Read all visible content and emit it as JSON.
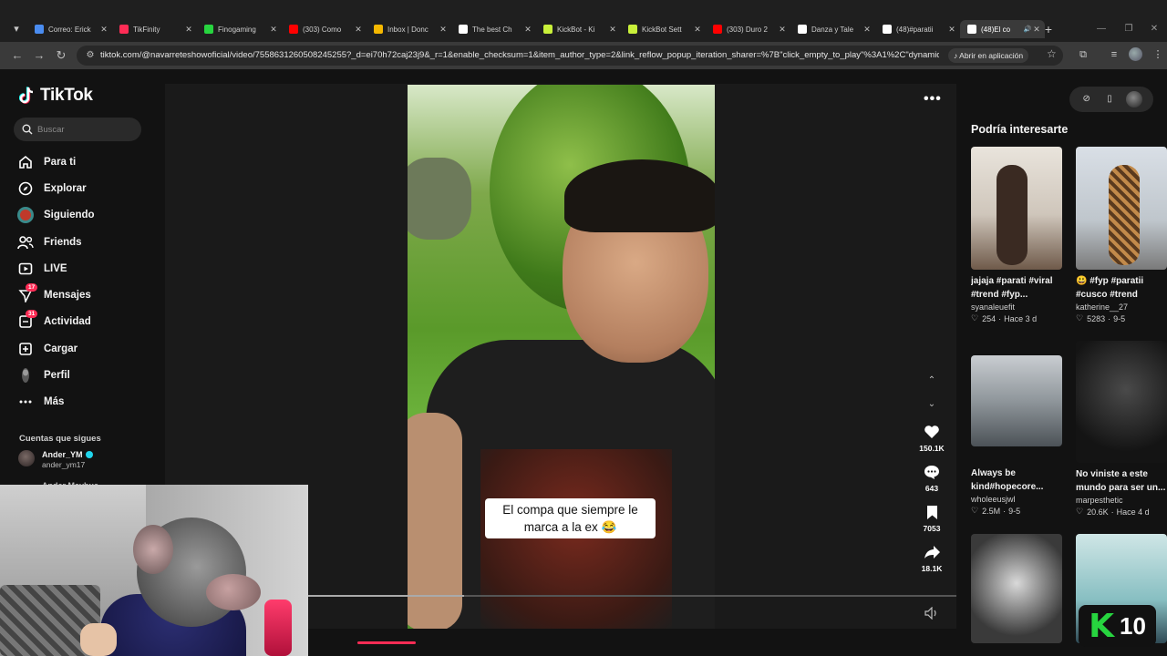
{
  "browser": {
    "tabs": [
      {
        "title": "Correo: Erick",
        "favicon_color": "#4a8cf0",
        "favicon_glyph": "mail-icon"
      },
      {
        "title": "TikFinity",
        "favicon_color": "#fe2c55",
        "favicon_glyph": "tikfinity-icon"
      },
      {
        "title": "Finogaming",
        "favicon_color": "#27d43f",
        "favicon_glyph": "k-icon"
      },
      {
        "title": "(303) Como",
        "favicon_color": "#ff0000",
        "favicon_glyph": "youtube-icon"
      },
      {
        "title": "Inbox | Donc",
        "favicon_color": "#f5b800",
        "favicon_glyph": "inbox-icon"
      },
      {
        "title": "The best Ch",
        "favicon_color": "#ffffff",
        "favicon_glyph": "diamond-icon"
      },
      {
        "title": "KickBot - Ki",
        "favicon_color": "#c9f03a",
        "favicon_glyph": "kickbot-icon"
      },
      {
        "title": "KickBot Sett",
        "favicon_color": "#c9f03a",
        "favicon_glyph": "kickbot-icon"
      },
      {
        "title": "(303) Duro 2",
        "favicon_color": "#ff0000",
        "favicon_glyph": "youtube-icon"
      },
      {
        "title": "Danza y Tale",
        "favicon_color": "#ffffff",
        "favicon_glyph": "tiktok-icon"
      },
      {
        "title": "(48)#paratii",
        "favicon_color": "#ffffff",
        "favicon_glyph": "tiktok-icon"
      },
      {
        "title": "(48)El co",
        "favicon_color": "#ffffff",
        "favicon_glyph": "tiktok-icon",
        "active": true
      }
    ],
    "url": "tiktok.com/@navarreteshowoficial/video/7558631260508245255?_d=ei70h72caj23j9&_r=1&enable_checksum=1&item_author_type=2&link_reflow_popup_iteration_sharer=%7B\"click_empty_to_play\"%3A1%2C\"dynamic_co...",
    "open_in_app": "Abrir en aplicación"
  },
  "tiktok": {
    "logo": "TikTok",
    "search_placeholder": "Buscar",
    "nav": [
      {
        "label": "Para ti",
        "icon": "home-icon"
      },
      {
        "label": "Explorar",
        "icon": "compass-icon"
      },
      {
        "label": "Siguiendo",
        "icon": "following-avatar-icon"
      },
      {
        "label": "Friends",
        "icon": "friends-icon"
      },
      {
        "label": "LIVE",
        "icon": "live-icon"
      },
      {
        "label": "Mensajes",
        "icon": "messages-icon",
        "badge": "17"
      },
      {
        "label": "Actividad",
        "icon": "activity-icon",
        "badge": "31"
      },
      {
        "label": "Cargar",
        "icon": "upload-icon"
      },
      {
        "label": "Perfil",
        "icon": "profile-icon"
      },
      {
        "label": "Más",
        "icon": "more-icon"
      }
    ],
    "following_header": "Cuentas que sigues",
    "following": [
      {
        "name": "Ander_YM",
        "handle": "ander_ym17",
        "verified": true
      },
      {
        "name": "Ander Mayhue"
      }
    ]
  },
  "video": {
    "caption_line1": "El compa que siempre le",
    "caption_line2": "marca a la ex 😂",
    "likes": "150.1K",
    "comments": "643",
    "saves": "7053",
    "shares": "18.1K",
    "progress_fraction": 0.24
  },
  "recommendations": {
    "header": "Podría interesarte",
    "cards": [
      {
        "title": "jajaja #parati #viral #trend #fyp...",
        "author": "syanaleuefit",
        "likes": "254",
        "date": "Hace 3 d"
      },
      {
        "title": "😃 #fyp #paratii #cusco #trend",
        "author": "katherine__27",
        "likes": "5283",
        "date": "9-5"
      },
      {
        "title": "Always be kind#hopecore...",
        "author": "wholeeusjwl",
        "likes": "2.5M",
        "date": "9-5"
      },
      {
        "title": "No viniste a este mundo para ser un...",
        "author": "marpesthetic",
        "likes": "20.6K",
        "date": "Hace 4 d"
      }
    ]
  },
  "overlay": {
    "badge_number": "10",
    "badge_color": "#27d43f"
  }
}
